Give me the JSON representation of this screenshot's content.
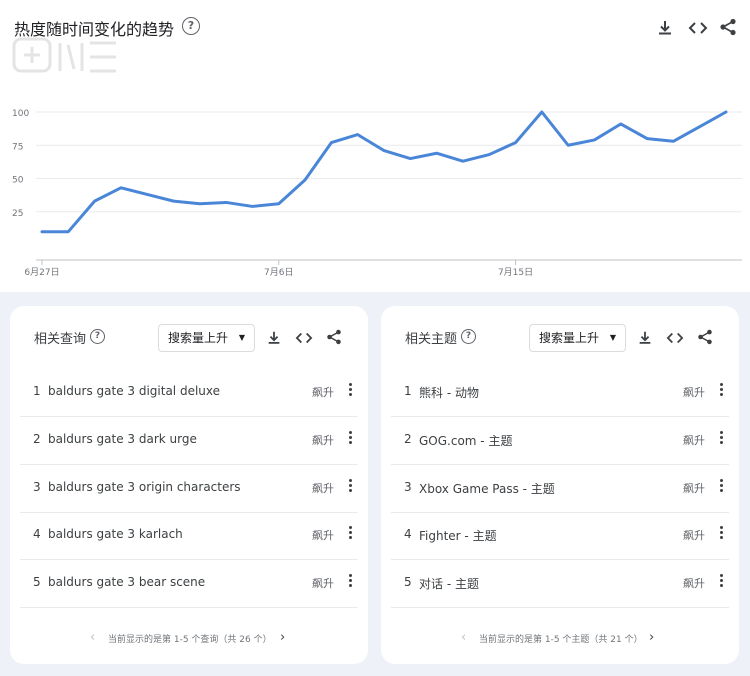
{
  "header": {
    "title": "热度随时间变化的趋势",
    "help_glyph": "?"
  },
  "chart_data": {
    "type": "line",
    "title": "热度随时间变化的趋势",
    "x": [
      "2023-06-27",
      "2023-06-28",
      "2023-06-29",
      "2023-06-30",
      "2023-07-01",
      "2023-07-02",
      "2023-07-03",
      "2023-07-04",
      "2023-07-05",
      "2023-07-06",
      "2023-07-07",
      "2023-07-08",
      "2023-07-09",
      "2023-07-10",
      "2023-07-11",
      "2023-07-12",
      "2023-07-13",
      "2023-07-14",
      "2023-07-15",
      "2023-07-16",
      "2023-07-17",
      "2023-07-18",
      "2023-07-19",
      "2023-07-20",
      "2023-07-21",
      "2023-07-22",
      "2023-07-23",
      "2023-07-24"
    ],
    "values": [
      10,
      10,
      33,
      43,
      38,
      33,
      31,
      32,
      29,
      31,
      49,
      77,
      83,
      71,
      65,
      69,
      63,
      68,
      77,
      100,
      75,
      79,
      91,
      80,
      78,
      89,
      100
    ],
    "x_tick_labels": [
      "6月27日",
      "7月6日",
      "7月15日"
    ],
    "y_ticks": [
      25,
      50,
      75,
      100
    ],
    "ylim": [
      0,
      100
    ],
    "line_color": "#4a86d8",
    "grid": true
  },
  "queries_card": {
    "title": "相关查询",
    "dropdown": "搜索量上升",
    "rows": [
      {
        "rank": "1",
        "label": "baldurs gate 3 digital deluxe",
        "value": "飙升"
      },
      {
        "rank": "2",
        "label": "baldurs gate 3 dark urge",
        "value": "飙升"
      },
      {
        "rank": "3",
        "label": "baldurs gate 3 origin characters",
        "value": "飙升"
      },
      {
        "rank": "4",
        "label": "baldurs gate 3 karlach",
        "value": "飙升"
      },
      {
        "rank": "5",
        "label": "baldurs gate 3 bear scene",
        "value": "飙升"
      }
    ],
    "pager": "当前显示的是第 1-5 个查询（共 26 个）"
  },
  "topics_card": {
    "title": "相关主题",
    "dropdown": "搜索量上升",
    "rows": [
      {
        "rank": "1",
        "label": "熊科 - 动物",
        "value": "飙升"
      },
      {
        "rank": "2",
        "label": "GOG.com - 主题",
        "value": "飙升"
      },
      {
        "rank": "3",
        "label": "Xbox Game Pass - 主题",
        "value": "飙升"
      },
      {
        "rank": "4",
        "label": "Fighter - 主题",
        "value": "飙升"
      },
      {
        "rank": "5",
        "label": "对话 - 主题",
        "value": "飙升"
      }
    ],
    "pager": "当前显示的是第 1-5 个主题（共 21 个）"
  },
  "icons": {
    "download": "download-icon",
    "embed": "embed-icon",
    "share": "share-icon",
    "more": "more-vert-icon",
    "prev": "chevron-left-icon",
    "next": "chevron-right-icon"
  },
  "arrows": {
    "prev": "‹",
    "next": "›"
  }
}
